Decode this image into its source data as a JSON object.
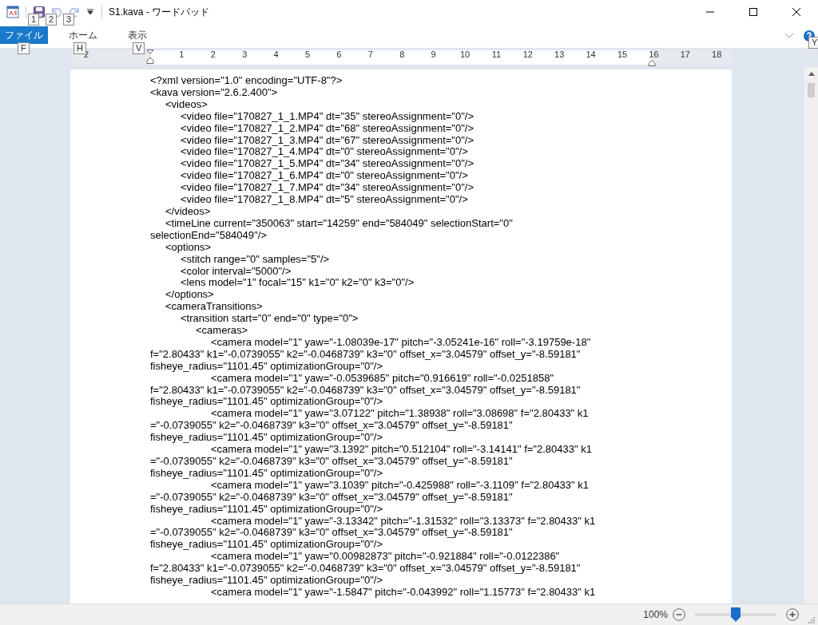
{
  "window": {
    "title": "S1.kava - ワードパッド"
  },
  "quick_access": [
    {
      "kind": "save",
      "keytip": "1",
      "disabled": false
    },
    {
      "kind": "undo",
      "keytip": "2",
      "disabled": true
    },
    {
      "kind": "redo",
      "keytip": "3",
      "disabled": true
    }
  ],
  "ribbon": {
    "tabs": [
      {
        "label": "ファイル",
        "kind": "file",
        "keytip": "F",
        "selected": false
      },
      {
        "label": "ホーム",
        "kind": "tab",
        "keytip": "H",
        "selected": false
      },
      {
        "label": "表示",
        "kind": "tab",
        "keytip": "V",
        "selected": false
      }
    ],
    "help_keytip": "Y"
  },
  "ruler": {
    "left_labels": [
      "2"
    ],
    "labels": [
      "1",
      "2",
      "3",
      "4",
      "5",
      "6",
      "7",
      "8",
      "9",
      "10",
      "11",
      "12",
      "13",
      "14",
      "15",
      "16",
      "17",
      "18"
    ]
  },
  "document": {
    "lines": [
      "<?xml version=\"1.0\" encoding=\"UTF-8\"?>",
      "<kava version=\"2.6.2.400\">",
      "\t<videos>",
      "\t\t<video file=\"170827_1_1.MP4\" dt=\"35\" stereoAssignment=\"0\"/>",
      "\t\t<video file=\"170827_1_2.MP4\" dt=\"68\" stereoAssignment=\"0\"/>",
      "\t\t<video file=\"170827_1_3.MP4\" dt=\"67\" stereoAssignment=\"0\"/>",
      "\t\t<video file=\"170827_1_4.MP4\" dt=\"0\" stereoAssignment=\"0\"/>",
      "\t\t<video file=\"170827_1_5.MP4\" dt=\"34\" stereoAssignment=\"0\"/>",
      "\t\t<video file=\"170827_1_6.MP4\" dt=\"0\" stereoAssignment=\"0\"/>",
      "\t\t<video file=\"170827_1_7.MP4\" dt=\"34\" stereoAssignment=\"0\"/>",
      "\t\t<video file=\"170827_1_8.MP4\" dt=\"5\" stereoAssignment=\"0\"/>",
      "\t</videos>",
      "\t<timeLine current=\"350063\" start=\"14259\" end=\"584049\" selectionStart=\"0\"",
      "selectionEnd=\"584049\"/>",
      "\t<options>",
      "\t\t<stitch range=\"0\" samples=\"5\"/>",
      "\t\t<color interval=\"5000\"/>",
      "\t\t<lens model=\"1\" focal=\"15\" k1=\"0\" k2=\"0\" k3=\"0\"/>",
      "\t</options>",
      "\t<cameraTransitions>",
      "\t\t<transition start=\"0\" end=\"0\" type=\"0\">",
      "\t\t\t<cameras>",
      "\t\t\t\t<camera model=\"1\" yaw=\"-1.08039e-17\" pitch=\"-3.05241e-16\" roll=\"-3.19759e-18\"",
      "f=\"2.80433\" k1=\"-0.0739055\" k2=\"-0.0468739\" k3=\"0\" offset_x=\"3.04579\" offset_y=\"-8.59181\"",
      "fisheye_radius=\"1101.45\" optimizationGroup=\"0\"/>",
      "\t\t\t\t<camera model=\"1\" yaw=\"-0.0539685\" pitch=\"0.916619\" roll=\"-0.0251858\"",
      "f=\"2.80433\" k1=\"-0.0739055\" k2=\"-0.0468739\" k3=\"0\" offset_x=\"3.04579\" offset_y=\"-8.59181\"",
      "fisheye_radius=\"1101.45\" optimizationGroup=\"0\"/>",
      "\t\t\t\t<camera model=\"1\" yaw=\"3.07122\" pitch=\"1.38938\" roll=\"3.08698\" f=\"2.80433\" k1",
      "=\"-0.0739055\" k2=\"-0.0468739\" k3=\"0\" offset_x=\"3.04579\" offset_y=\"-8.59181\"",
      "fisheye_radius=\"1101.45\" optimizationGroup=\"0\"/>",
      "\t\t\t\t<camera model=\"1\" yaw=\"3.1392\" pitch=\"0.512104\" roll=\"-3.14141\" f=\"2.80433\" k1",
      "=\"-0.0739055\" k2=\"-0.0468739\" k3=\"0\" offset_x=\"3.04579\" offset_y=\"-8.59181\"",
      "fisheye_radius=\"1101.45\" optimizationGroup=\"0\"/>",
      "\t\t\t\t<camera model=\"1\" yaw=\"3.1039\" pitch=\"-0.425988\" roll=\"-3.1109\" f=\"2.80433\" k1",
      "=\"-0.0739055\" k2=\"-0.0468739\" k3=\"0\" offset_x=\"3.04579\" offset_y=\"-8.59181\"",
      "fisheye_radius=\"1101.45\" optimizationGroup=\"0\"/>",
      "\t\t\t\t<camera model=\"1\" yaw=\"-3.13342\" pitch=\"-1.31532\" roll=\"3.13373\" f=\"2.80433\" k1",
      "=\"-0.0739055\" k2=\"-0.0468739\" k3=\"0\" offset_x=\"3.04579\" offset_y=\"-8.59181\"",
      "fisheye_radius=\"1101.45\" optimizationGroup=\"0\"/>",
      "\t\t\t\t<camera model=\"1\" yaw=\"0.00982873\" pitch=\"-0.921884\" roll=\"-0.0122386\"",
      "f=\"2.80433\" k1=\"-0.0739055\" k2=\"-0.0468739\" k3=\"0\" offset_x=\"3.04579\" offset_y=\"-8.59181\"",
      "fisheye_radius=\"1101.45\" optimizationGroup=\"0\"/>",
      "\t\t\t\t<camera model=\"1\" yaw=\"-1.5847\" pitch=\"-0.043992\" roll=\"1.15773\" f=\"2.80433\" k1"
    ]
  },
  "status_bar": {
    "zoom": "100%",
    "zoom_slider": {
      "level": 0.5
    }
  }
}
